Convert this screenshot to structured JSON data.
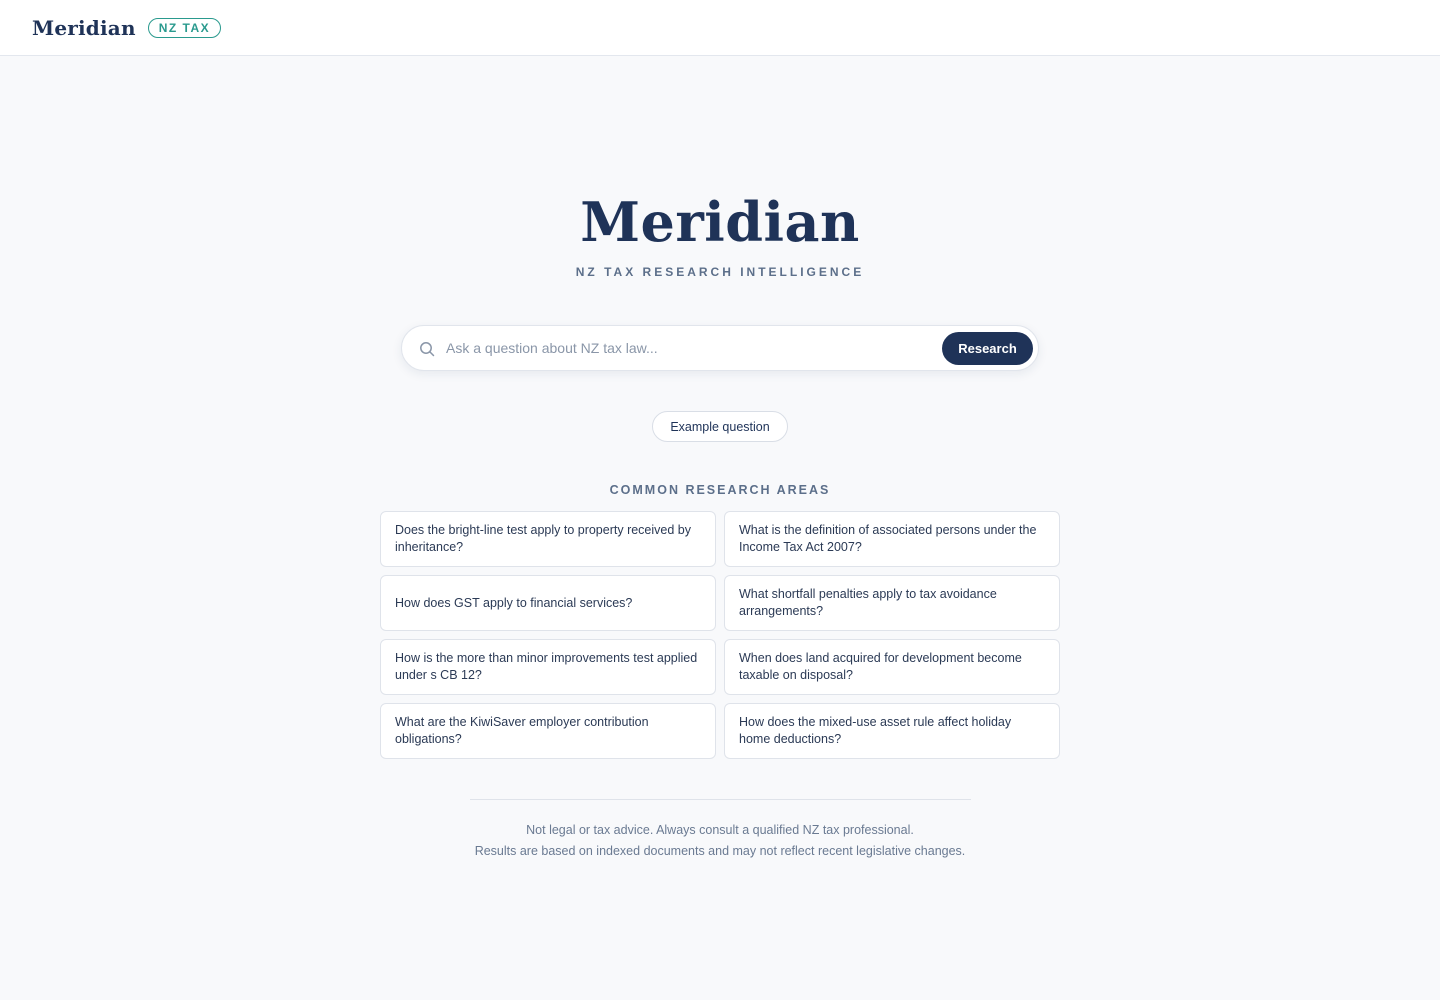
{
  "header": {
    "brand": "Meridian",
    "tag": "NZ TAX"
  },
  "hero": {
    "title": "Meridian",
    "subtitle": "NZ TAX RESEARCH INTELLIGENCE"
  },
  "search": {
    "icon": "search-icon",
    "placeholder": "Ask a question about NZ tax law...",
    "value": "",
    "button_label": "Research"
  },
  "example_button_label": "Example question",
  "research_areas": {
    "title": "COMMON RESEARCH AREAS",
    "items": [
      "Does the bright-line test apply to property received by inheritance?",
      "What is the definition of associated persons under the Income Tax Act 2007?",
      "How does GST apply to financial services?",
      "What shortfall penalties apply to tax avoidance arrangements?",
      "How is the more than minor improvements test applied under s CB 12?",
      "When does land acquired for development become taxable on disposal?",
      "What are the KiwiSaver employer contribution obligations?",
      "How does the mixed-use asset rule affect holiday home deductions?"
    ]
  },
  "footer": {
    "line1": "Not legal or tax advice. Always consult a qualified NZ tax professional.",
    "line2": "Results are based on indexed documents and may not reflect recent legislative changes."
  },
  "colors": {
    "primary": "#1f3358",
    "accent": "#2a9a8e",
    "background": "#f8f9fb"
  }
}
